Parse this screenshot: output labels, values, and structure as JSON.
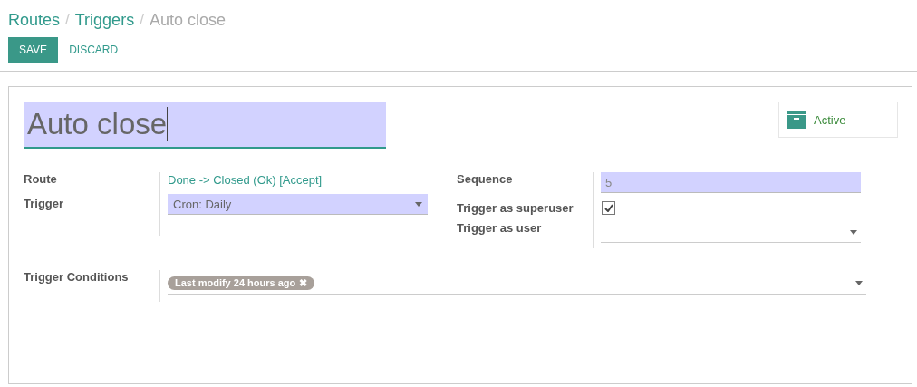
{
  "breadcrumbs": [
    {
      "label": "Routes",
      "current": false
    },
    {
      "label": "Triggers",
      "current": false
    },
    {
      "label": "Auto close",
      "current": true
    }
  ],
  "separator": "/",
  "buttons": [
    {
      "label": "SAVE",
      "primary": true
    },
    {
      "label": "DISCARD",
      "primary": false
    }
  ],
  "title": {
    "value": "Auto close"
  },
  "active_toggle": {
    "label": "Active"
  },
  "left_fields": [
    {
      "label": "Route",
      "kind": "link",
      "value": "Done -> Closed (Ok) [Accept]"
    },
    {
      "label": "Trigger",
      "kind": "select",
      "value": "Cron: Daily"
    }
  ],
  "right_fields": [
    {
      "label": "Sequence",
      "kind": "input",
      "value": "5"
    },
    {
      "label": "Trigger as superuser",
      "kind": "checkbox",
      "checked": true
    },
    {
      "label": "Trigger as user",
      "kind": "dropdown"
    }
  ],
  "conditions": {
    "label": "Trigger Conditions",
    "tags": [
      {
        "label": "Last modify 24 hours ago",
        "remove": "✖"
      }
    ]
  }
}
